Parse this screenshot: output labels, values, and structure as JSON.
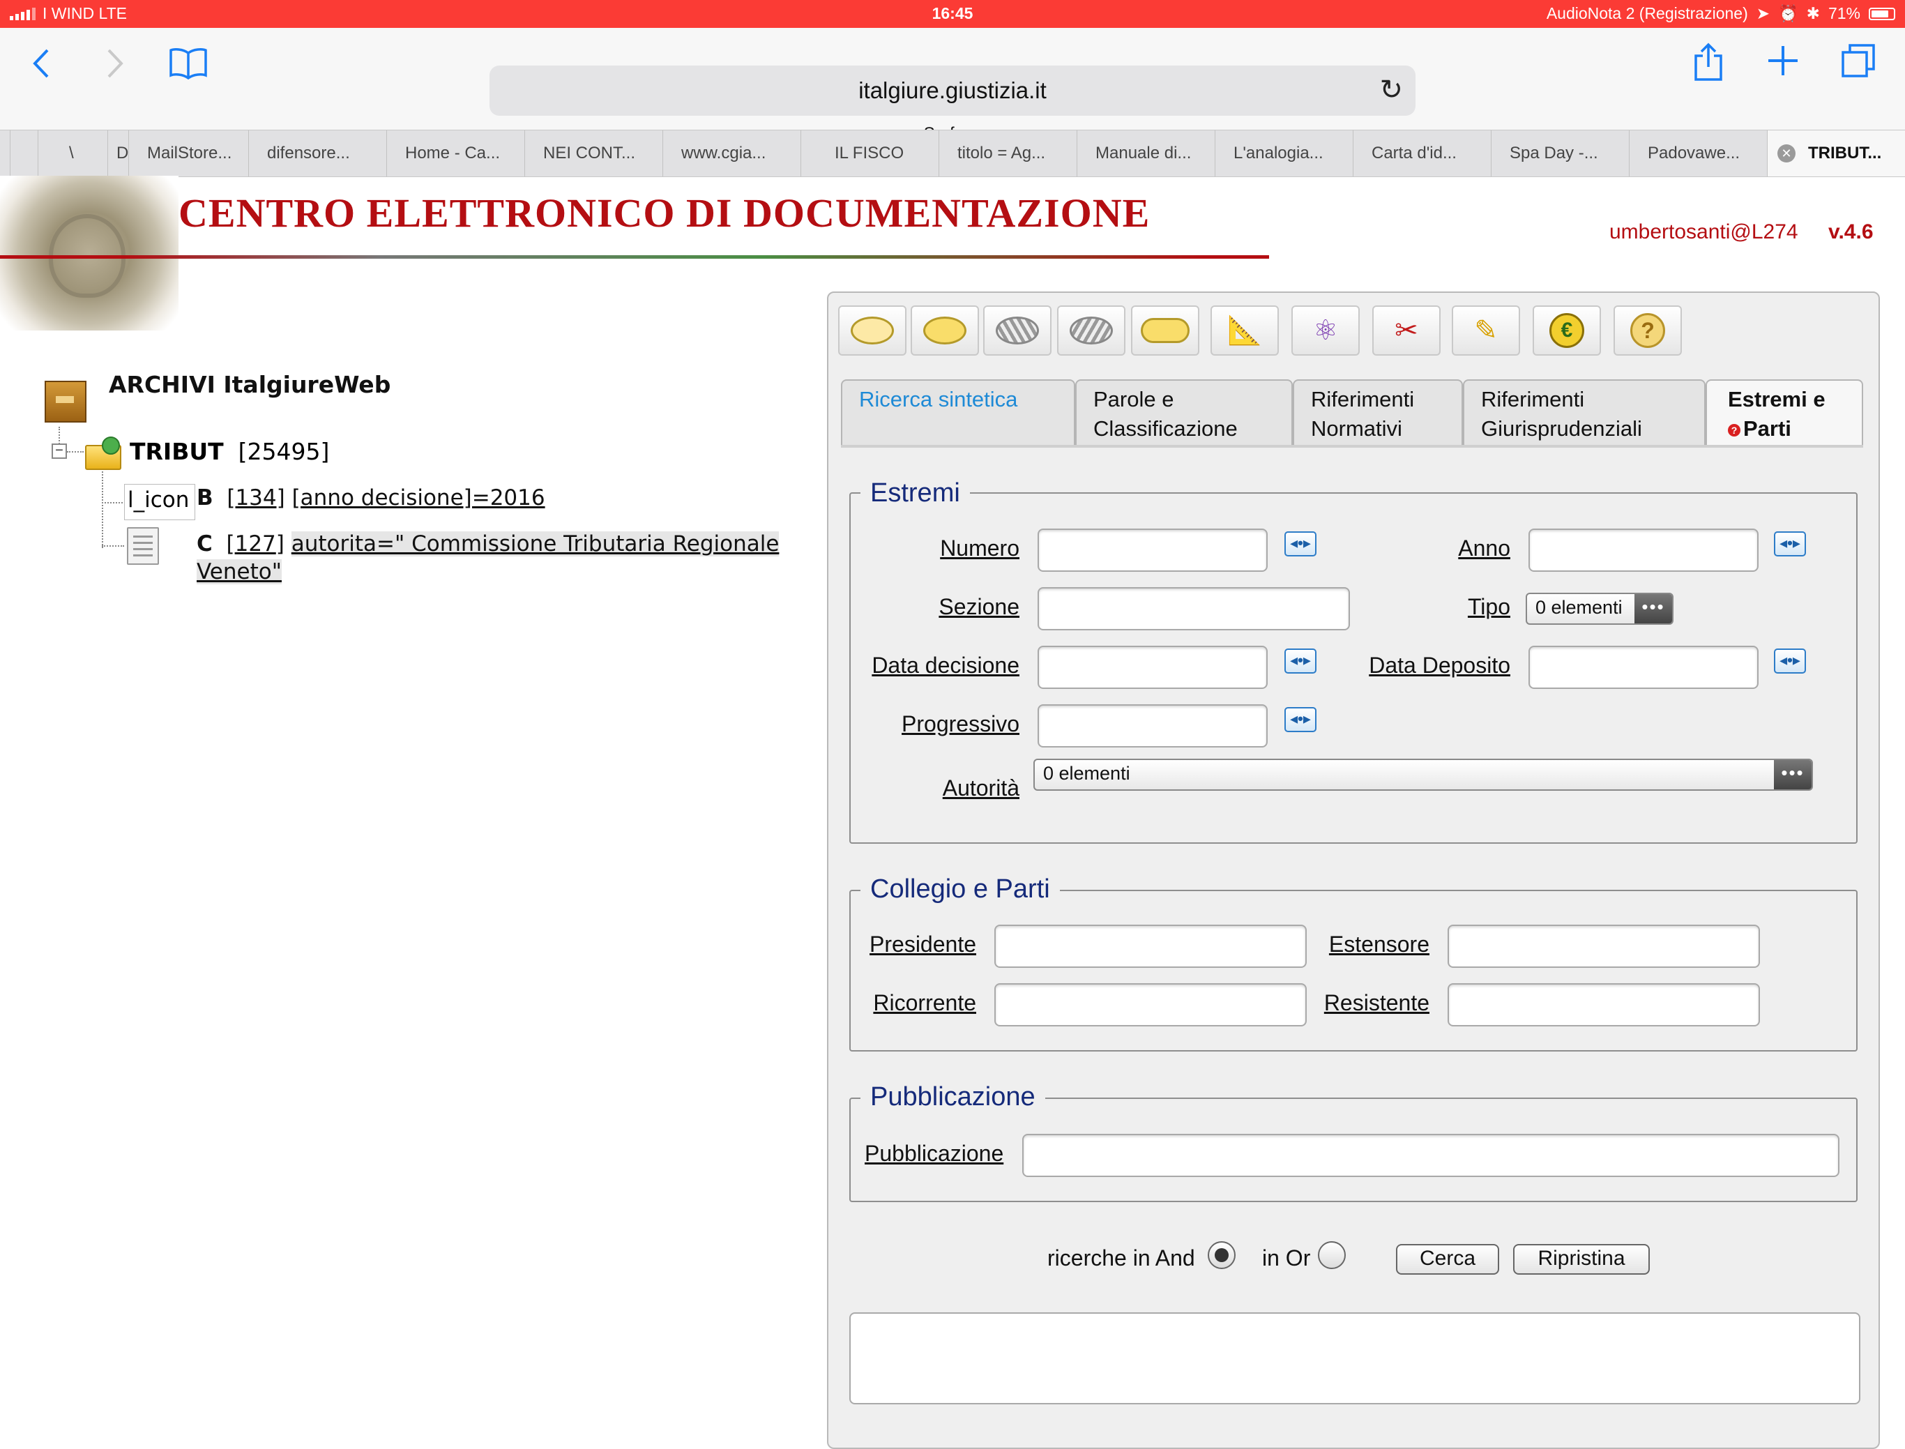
{
  "status_bar": {
    "carrier": "I WIND  LTE",
    "time": "16:45",
    "recording": "AudioNota 2 (Registrazione)",
    "battery": "71%"
  },
  "browser": {
    "url": "italgiure.giustizia.it",
    "page_title": "Surface",
    "tabs": [
      "\\",
      "D",
      "MailStore...",
      "difensore...",
      "Home - Ca...",
      "NEI CONT...",
      "www.cgia...",
      "IL FISCO",
      "titolo = Ag...",
      "Manuale di...",
      "L'analogia...",
      "Carta d'id...",
      "Spa Day -...",
      "Padovawe...",
      "TRIBUT..."
    ],
    "tab_close_glyph": "✕"
  },
  "header": {
    "title": "CENTRO ELETTRONICO DI DOCUMENTAZIONE",
    "user": "umbertosanti@L274",
    "version": "v.4.6"
  },
  "tree": {
    "root_label": "ARCHIVI ItalgiureWeb",
    "archive_name": "TRIBUT",
    "archive_count": "[25495]",
    "placeholder_icon": "l_icon",
    "row_b": {
      "letter": "B",
      "count": "[134]",
      "query": "[anno decisione]=2016"
    },
    "row_c": {
      "letter": "C",
      "count_open": "[",
      "count_num": "127",
      "count_close": "]",
      "query_line1": "autorita=\" Commissione Tributaria Regionale",
      "query_line2": "Veneto\""
    }
  },
  "toolbar_icons": [
    "ellipse-outline-icon",
    "ellipse-filled-icon",
    "ellipse-hatched-icon",
    "ellipse-hatched-alt-icon",
    "pill-icon",
    "ruler-icon",
    "atom-icon",
    "scissors-icon",
    "eraser-icon",
    "euro-icon",
    "help-icon"
  ],
  "form_tabs": [
    {
      "line1": "Ricerca sintetica",
      "line2": ""
    },
    {
      "line1": "Parole e",
      "line2": "Classificazione"
    },
    {
      "line1": "Riferimenti",
      "line2": "Normativi"
    },
    {
      "line1": "Riferimenti",
      "line2": "Giurisprudenziali"
    },
    {
      "line1": "Estremi e",
      "line2": "Parti"
    }
  ],
  "estremi": {
    "legend": "Estremi",
    "numero": "Numero",
    "anno": "Anno",
    "sezione": "Sezione",
    "tipo": "Tipo",
    "tipo_value": "0 elementi",
    "data_decisione": "Data decisione",
    "data_deposito": "Data Deposito",
    "progressivo": "Progressivo",
    "autorita": "Autorità",
    "autorita_value": "0 elementi",
    "range_glyph": "◂•▸",
    "more_glyph": "•••"
  },
  "collegio": {
    "legend": "Collegio e Parti",
    "presidente": "Presidente",
    "estensore": "Estensore",
    "ricorrente": "Ricorrente",
    "resistente": "Resistente"
  },
  "pubblicazione": {
    "legend": "Pubblicazione",
    "label": "Pubblicazione"
  },
  "search_mode": {
    "and_label": "ricerche in And",
    "or_label": "in Or",
    "selected": "And"
  },
  "actions": {
    "search": "Cerca",
    "reset": "Ripristina"
  },
  "colors": {
    "status_bar": "#fb3b35",
    "brand_red": "#b40e12",
    "link_blue": "#1a7ef5",
    "legend_navy": "#152a7a"
  }
}
